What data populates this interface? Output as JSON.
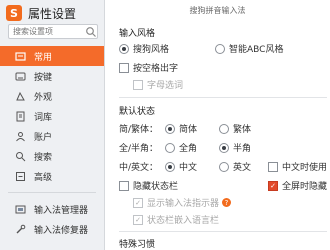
{
  "app": {
    "title": "属性设置",
    "logo_letter": "S"
  },
  "search": {
    "placeholder": "搜索设置项"
  },
  "sidebar": {
    "items": [
      {
        "label": "常用",
        "icon": "home-icon",
        "active": true
      },
      {
        "label": "按键",
        "icon": "keyboard-icon"
      },
      {
        "label": "外观",
        "icon": "palette-icon"
      },
      {
        "label": "词库",
        "icon": "book-icon"
      },
      {
        "label": "账户",
        "icon": "user-icon"
      },
      {
        "label": "搜索",
        "icon": "search-icon"
      },
      {
        "label": "高级",
        "icon": "settings-icon"
      }
    ],
    "tools": [
      {
        "label": "输入法管理器",
        "icon": "manager-icon"
      },
      {
        "label": "输入法修复器",
        "icon": "repair-icon"
      }
    ]
  },
  "main": {
    "subtitle": "搜狗拼音输入法",
    "input_style": {
      "title": "输入风格",
      "option_sogou": "搜狗风格",
      "option_abc": "智能ABC风格",
      "space_output": "按空格出字",
      "word_select": "字母选词"
    },
    "default_state": {
      "title": "默认状态",
      "simp_trad_label": "简/繁体：",
      "simp": "简体",
      "trad": "繁体",
      "width_label": "全/半角：",
      "full": "全角",
      "half": "半角",
      "lang_label": "中/英文：",
      "chinese": "中文",
      "english": "英文",
      "chinese_punct": "中文时使用",
      "hide_status": "隐藏状态栏",
      "fullscreen_hide": "全屏时隐藏",
      "show_indicator": "显示输入法指示器",
      "embed_status": "状态栏嵌入语言栏"
    },
    "habits": {
      "title": "特殊习惯"
    }
  }
}
